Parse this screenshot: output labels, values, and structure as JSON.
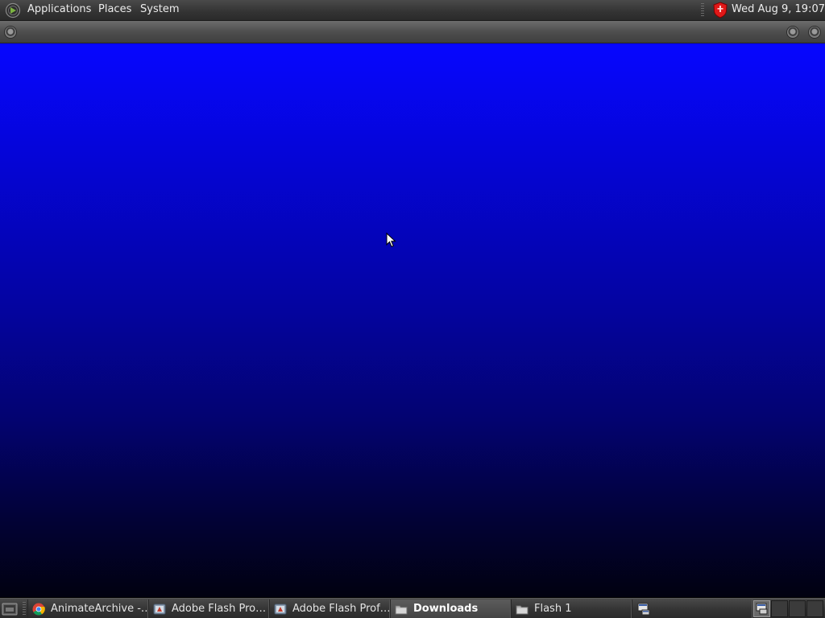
{
  "top_panel": {
    "menus": [
      "Applications",
      "Places",
      "System"
    ],
    "clock": "Wed Aug  9, 19:07",
    "tray_icons": [
      "shield-icon"
    ]
  },
  "desktop": {
    "background_colors": [
      "#0606ff",
      "#030370",
      "#010110"
    ]
  },
  "taskbar": {
    "tasks": [
      {
        "label": "AnimateArchive -…",
        "icon": "chrome-icon",
        "active": false
      },
      {
        "label": "Adobe Flash Pro…",
        "icon": "flash-app-icon",
        "active": false
      },
      {
        "label": "Adobe Flash Prof…",
        "icon": "flash-app-icon",
        "active": false
      },
      {
        "label": "Downloads",
        "icon": "folder-icon",
        "active": true
      },
      {
        "label": "Flash 1",
        "icon": "folder-icon",
        "active": false
      },
      {
        "label": "",
        "icon": "network-window-icon",
        "active": false
      }
    ],
    "workspaces": 4,
    "current_workspace": 1
  }
}
